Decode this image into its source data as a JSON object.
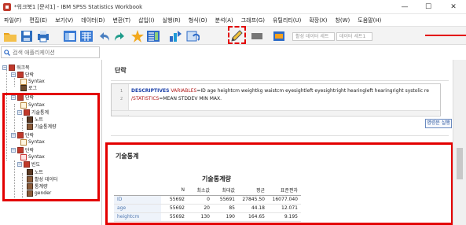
{
  "window": {
    "title": "*워크북1 [문서1] - IBM SPSS Statistics Workbook",
    "minimize_glyph": "—",
    "maximize_glyph": "☐",
    "close_glyph": "✕"
  },
  "menu": {
    "items": [
      "파일(F)",
      "편집(E)",
      "보기(V)",
      "데이터(D)",
      "변환(T)",
      "삽입(I)",
      "실행(R)",
      "형식(O)",
      "분석(A)",
      "그래프(G)",
      "유틸리티(U)",
      "확장(X)",
      "창(W)",
      "도움말(H)"
    ]
  },
  "toolbar": {
    "buttons": [
      {
        "icon": "open-folder-icon",
        "color": "#e8a21c"
      },
      {
        "icon": "save-icon",
        "color": "#2f6fbf"
      },
      {
        "icon": "print-icon",
        "color": "#2f6fbf"
      },
      {
        "icon": "dialog-recall-icon",
        "color": "#3a7bd5"
      },
      {
        "icon": "data-editor-icon",
        "color": "#3a7bd5"
      },
      {
        "icon": "undo-icon",
        "color": "#4a7fc0"
      },
      {
        "icon": "redo-icon",
        "color": "#1e9b8a"
      },
      {
        "icon": "star-icon",
        "color": "#f2a81d"
      },
      {
        "icon": "variables-icon",
        "color": "#2e6bc7"
      },
      {
        "icon": "chart-builder-icon",
        "color": "#2e6bc7"
      },
      {
        "icon": "paragraph-icon",
        "color": "#2e6bc7"
      },
      {
        "icon": "edit-pencil-icon",
        "color": "#555555"
      },
      {
        "icon": "run-icon",
        "color": "#777777"
      },
      {
        "icon": "mode-icon",
        "color": "#2e6bc7"
      }
    ],
    "combo_left": "활성 데이터 세트",
    "combo_right": "데이터 세트1"
  },
  "search": {
    "placeholder": "검색 애플리케이션"
  },
  "tree": {
    "nodes": [
      {
        "label": "워크북",
        "icon": "workbook-icon"
      },
      {
        "label": "단락",
        "icon": "paragraph-icon"
      },
      {
        "label": "Syntax",
        "icon": "syntax-icon"
      },
      {
        "label": "로그",
        "icon": "log-icon"
      },
      {
        "label": "단락",
        "icon": "paragraph-icon"
      },
      {
        "label": "Syntax",
        "icon": "syntax-icon"
      },
      {
        "label": "기술통계",
        "icon": "output-folder-icon"
      },
      {
        "label": "노트",
        "icon": "notes-icon"
      },
      {
        "label": "기술통계량",
        "icon": "table-icon"
      },
      {
        "label": "단락",
        "icon": "paragraph-icon"
      },
      {
        "label": "Syntax",
        "icon": "syntax-icon"
      },
      {
        "label": "단락",
        "icon": "paragraph-icon"
      },
      {
        "label": "Syntax",
        "icon": "syntax-icon"
      },
      {
        "label": "빈도",
        "icon": "output-folder-icon"
      },
      {
        "label": "노트",
        "icon": "notes-icon"
      },
      {
        "label": "활성 데이터",
        "icon": "dataset-icon"
      },
      {
        "label": "통계량",
        "icon": "table-icon"
      },
      {
        "label": "gender",
        "icon": "table-icon"
      }
    ]
  },
  "content": {
    "paragraph_heading": "단락",
    "syntax": {
      "line1_number": "1",
      "line2_number": "2",
      "line1_keyword": "DESCRIPTIVES",
      "line1_subcmd": "VARIABLES",
      "line1_rest": "=ID age heightcm weightkg waistcm eyesightleft eyesightright hearingleft hearingright systolic re",
      "line2_subcmd": "/STATISTICS",
      "line2_rest": "=MEAN STDDEV MIN MAX."
    },
    "run_button": "명령문 실행",
    "stats_heading": "기술통계",
    "table": {
      "title": "기술통계량",
      "columns": [
        "",
        "N",
        "최소값",
        "최대값",
        "평균",
        "표준편차"
      ],
      "rows": [
        [
          "ID",
          "55692",
          "0",
          "55691",
          "27845.50",
          "16077.040"
        ],
        [
          "age",
          "55692",
          "20",
          "85",
          "44.18",
          "12.071"
        ],
        [
          "heightcm",
          "55692",
          "130",
          "190",
          "164.65",
          "9.195"
        ]
      ]
    }
  },
  "colors": {
    "highlight": "#e30000",
    "keyword": "#1a3fa8",
    "subcommand": "#b01818"
  }
}
